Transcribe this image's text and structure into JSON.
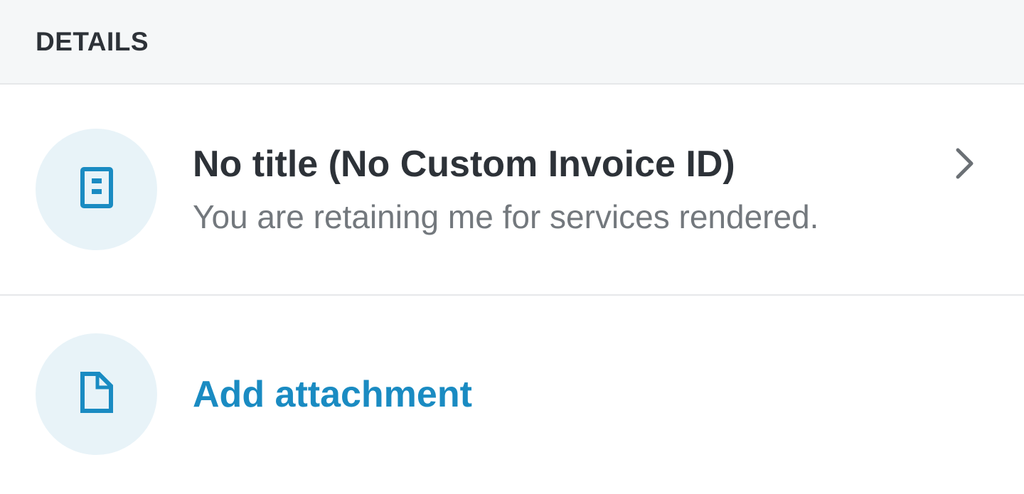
{
  "section": {
    "label": "DETAILS"
  },
  "details_row": {
    "title": "No title (No Custom Invoice ID)",
    "description": "You are retaining me for services rendered.",
    "icon": "invoice-document-icon",
    "trailing_icon": "chevron-right-icon"
  },
  "attachment_row": {
    "label": "Add attachment",
    "icon": "file-icon"
  },
  "colors": {
    "accent": "#1a8bc2",
    "icon_circle_bg": "#e8f3f8",
    "header_bg": "#f5f7f8",
    "title_text": "#2d3238",
    "secondary_text": "#73787d",
    "chevron": "#6b7075"
  }
}
